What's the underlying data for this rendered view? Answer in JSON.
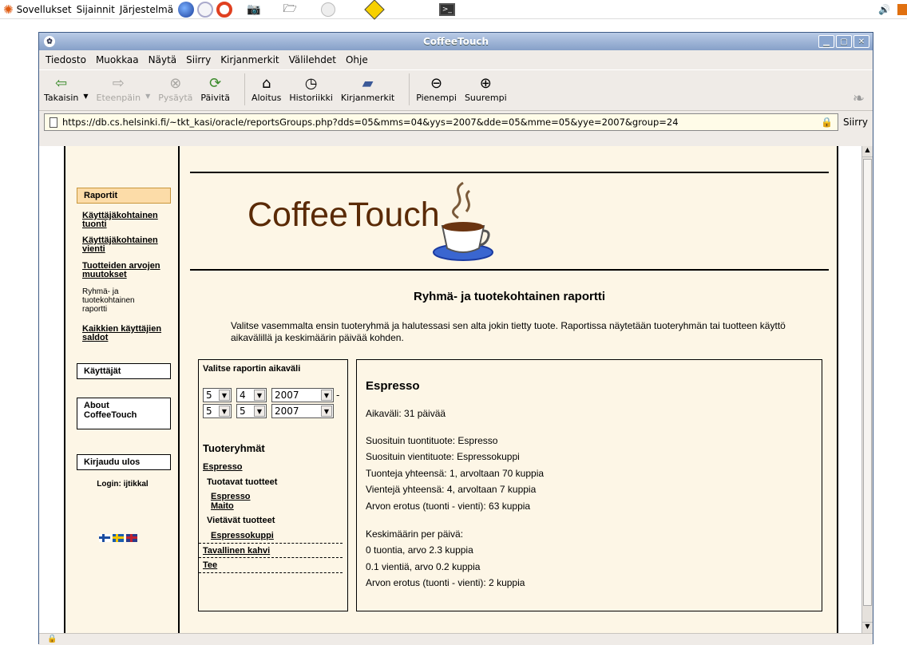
{
  "panel": {
    "menus": [
      "Sovellukset",
      "Sijainnit",
      "Järjestelmä"
    ]
  },
  "window": {
    "title": "CoffeeTouch"
  },
  "menubar": [
    "Tiedosto",
    "Muokkaa",
    "Näytä",
    "Siirry",
    "Kirjanmerkit",
    "Välilehdet",
    "Ohje"
  ],
  "toolbar": {
    "back": "Takaisin",
    "forward": "Eteenpäin",
    "stop": "Pysäytä",
    "reload": "Päivitä",
    "home": "Aloitus",
    "history": "Historiikki",
    "bookmarks": "Kirjanmerkit",
    "zoom_out": "Pienempi",
    "zoom_in": "Suurempi"
  },
  "address": {
    "url": "https://db.cs.helsinki.fi/~tkt_kasi/oracle/reportsGroups.php?dds=05&mms=04&yys=2007&dde=05&mme=05&yye=2007&group=24",
    "go": "Siirry"
  },
  "nav": {
    "raportit": "Raportit",
    "link1": "Käyttäjäkohtainen tuonti",
    "link2": "Käyttäjäkohtainen vienti",
    "link3": "Tuotteiden arvojen muutokset",
    "current": "Ryhmä- ja tuotekohtainen raportti",
    "link4": "Kaikkien käyttäjien saldot",
    "users": "Käyttäjät",
    "about": "About CoffeeTouch",
    "logout": "Kirjaudu ulos",
    "login": "Login: ijtikkal"
  },
  "page": {
    "logo": "CoffeeTouch",
    "heading": "Ryhmä- ja tuotekohtainen raportti",
    "intro": "Valitse vasemmalta ensin tuoteryhmä ja halutessasi sen alta jokin tietty tuote. Raportissa näytetään tuoteryhmän tai tuotteen käyttö aikavälillä ja keskimäärin päivää kohden."
  },
  "filter": {
    "label": "Valitse raportin aikaväli",
    "start": {
      "day": "5",
      "month": "4",
      "year": "2007"
    },
    "end": {
      "day": "5",
      "month": "5",
      "year": "2007"
    },
    "dash": "-",
    "groups_title": "Tuoteryhmät",
    "group1": "Espresso",
    "imports_title": "Tuotavat tuotteet",
    "import1": "Espresso",
    "import2": "Maito",
    "exports_title": "Vietävät tuotteet",
    "export1": "Espressokuppi",
    "group2": "Tavallinen kahvi",
    "group3": "Tee"
  },
  "report": {
    "title": "Espresso",
    "period": "Aikaväli: 31 päivää",
    "top_import": "Suosituin tuontituote: Espresso",
    "top_export": "Suosituin vientituote: Espressokuppi",
    "imports_total": "Tuonteja yhteensä: 1, arvoltaan 70 kuppia",
    "exports_total": "Vientejä yhteensä: 4, arvoltaan 7 kuppia",
    "diff": "Arvon erotus (tuonti - vienti): 63 kuppia",
    "avg_title": "Keskimäärin per päivä:",
    "avg_imports": "0 tuontia, arvo 2.3 kuppia",
    "avg_exports": "0.1 vientiä, arvo 0.2 kuppia",
    "avg_diff": "Arvon erotus (tuonti - vienti): 2 kuppia"
  }
}
